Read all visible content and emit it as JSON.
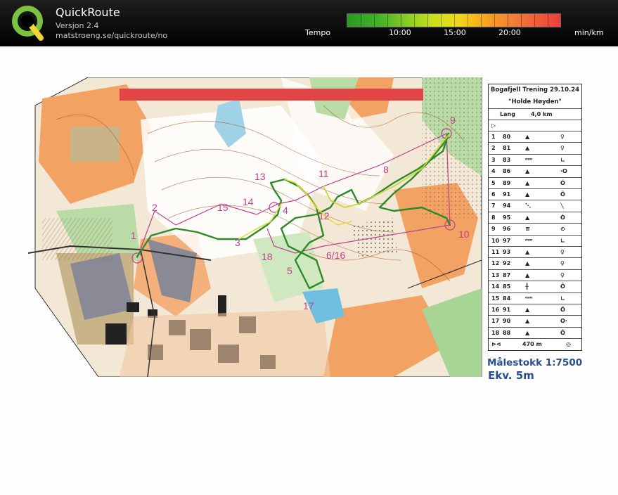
{
  "app": {
    "title": "QuickRoute",
    "version": "Versjon 2.4",
    "url": "matstroeng.se/quickroute/no"
  },
  "tempo_scale": {
    "label": "Tempo",
    "ticks": [
      "10:00",
      "15:00",
      "20:00"
    ],
    "unit": "min/km",
    "colors": [
      "#2a9a24",
      "#88cc24",
      "#f0d818",
      "#f7a020",
      "#ec3c3c"
    ]
  },
  "control_card": {
    "title": "Bogafjell Trening 29.10.24",
    "subtitle": "\"Holde Høyden\"",
    "course": "Lang",
    "length": "4,0 km",
    "start_symbol": "▷",
    "rows": [
      {
        "num": "1",
        "code": "80",
        "feature": "▲",
        "detail": "♀"
      },
      {
        "num": "2",
        "code": "81",
        "feature": "▲",
        "detail": "♀"
      },
      {
        "num": "3",
        "code": "83",
        "feature": "ᵐᵐ",
        "detail": "∟"
      },
      {
        "num": "4",
        "code": "86",
        "feature": "▲",
        "detail": "·O"
      },
      {
        "num": "5",
        "code": "89",
        "feature": "▲",
        "detail": "Ó"
      },
      {
        "num": "6",
        "code": "91",
        "feature": "▲",
        "detail": "Ô"
      },
      {
        "num": "7",
        "code": "94",
        "feature": "⋱",
        "detail": "╲"
      },
      {
        "num": "8",
        "code": "95",
        "feature": "▲",
        "detail": "Ó"
      },
      {
        "num": "9",
        "code": "96",
        "feature": "≡",
        "detail": "⊙"
      },
      {
        "num": "10",
        "code": "97",
        "feature": "ᵐᵐ",
        "detail": "∟"
      },
      {
        "num": "11",
        "code": "93",
        "feature": "▲",
        "detail": "♀"
      },
      {
        "num": "12",
        "code": "92",
        "feature": "▲",
        "detail": "♀"
      },
      {
        "num": "13",
        "code": "87",
        "feature": "▲",
        "detail": "♀"
      },
      {
        "num": "14",
        "code": "85",
        "feature": "╫",
        "detail": "Ō"
      },
      {
        "num": "15",
        "code": "84",
        "feature": "ᵐᵐ",
        "detail": "∟"
      },
      {
        "num": "16",
        "code": "91",
        "feature": "▲",
        "detail": "Ô"
      },
      {
        "num": "17",
        "code": "90",
        "feature": "▲",
        "detail": "O·"
      },
      {
        "num": "18",
        "code": "88",
        "feature": "▲",
        "detail": "Ô"
      }
    ],
    "finish_distance": "470 m"
  },
  "map": {
    "control_labels": [
      "1",
      "2",
      "3",
      "4",
      "5",
      "6/16",
      "8",
      "9",
      "10",
      "11",
      "12",
      "13",
      "14",
      "15",
      "17",
      "18"
    ],
    "scale": "Målestokk 1:7500",
    "equidistance": "Ekv. 5m"
  }
}
